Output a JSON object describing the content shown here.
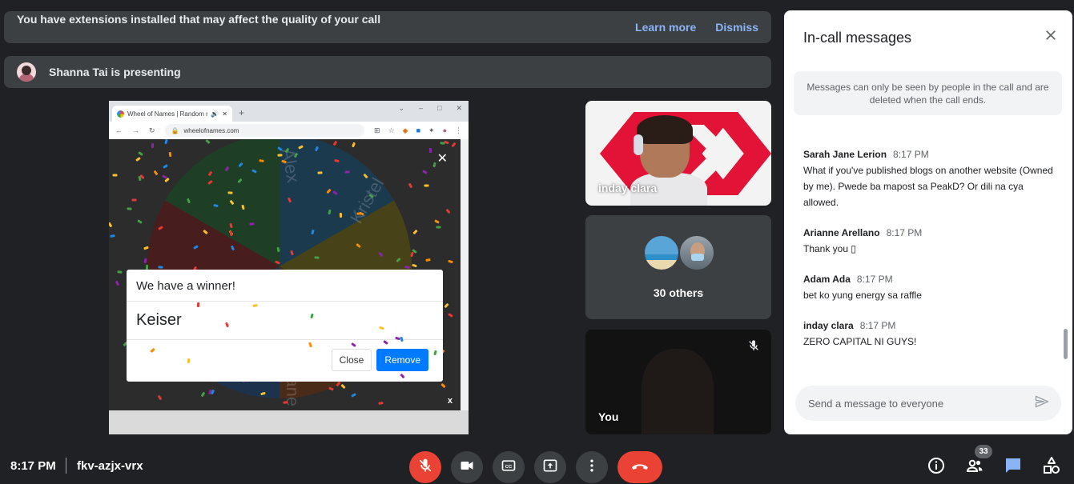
{
  "banner": {
    "message": "You have extensions installed that may affect the quality of your call",
    "learn_more": "Learn more",
    "dismiss": "Dismiss"
  },
  "presenting": {
    "text": "Shanna Tai is presenting"
  },
  "shared_screen": {
    "tab_title": "Wheel of Names | Random n",
    "url": "wheelofnames.com",
    "modal": {
      "title": "We have a winner!",
      "winner": "Keiser",
      "close_label": "Close",
      "remove_label": "Remove"
    },
    "wheel_labels": [
      "Alex",
      "Kristel",
      "ah Jane"
    ]
  },
  "tiles": {
    "tile1_name": "inday clara",
    "others_label": "30 others",
    "self_label": "You"
  },
  "chat": {
    "title": "In-call messages",
    "notice": "Messages can only be seen by people in the call and are deleted when the call ends.",
    "messages": [
      {
        "sender": "Sarah Jane Lerion",
        "time": "8:17 PM",
        "text": "What if you've published blogs on another website (Owned by me). Pwede ba mapost sa PeakD? Or dili na cya allowed."
      },
      {
        "sender": "Arianne Arellano",
        "time": "8:17 PM",
        "text": "Thank you ▯"
      },
      {
        "sender": "Adam Ada",
        "time": "8:17 PM",
        "text": "bet ko yung energy sa raffle"
      },
      {
        "sender": "inday clara",
        "time": "8:17 PM",
        "text": "ZERO CAPITAL NI GUYS!"
      }
    ],
    "input_placeholder": "Send a message to everyone"
  },
  "bottom": {
    "time": "8:17 PM",
    "meeting_code": "fkv-azjx-vrx",
    "participants_count": "33"
  },
  "colors": {
    "background": "#202124",
    "end_call": "#ea4335",
    "accent": "#8ab4f8",
    "chat_active": "#8ab4f8"
  }
}
